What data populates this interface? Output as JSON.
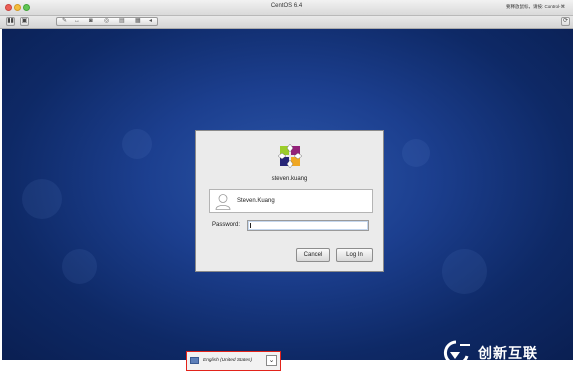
{
  "window": {
    "title": "CentOS 6.4",
    "hint": "要释放鼠标，请按: Control-⌘"
  },
  "toolbar": {
    "icons": [
      "pause-icon",
      "snapshot-icon",
      "settings-icon",
      "resize-icon",
      "lock-icon",
      "disk-icon",
      "usb-icon",
      "share-icon",
      "back-icon",
      "fullscreen-icon"
    ]
  },
  "login": {
    "hostname": "steven.kuang",
    "user_name": "Steven.Kuang",
    "password_label": "Password:",
    "password_value": "",
    "cancel_label": "Cancel",
    "login_label": "Log In"
  },
  "panel": {
    "language": "English (United States)"
  },
  "watermark": {
    "text": "创新互联"
  },
  "colors": {
    "highlight": "#e2231a",
    "desktop": "#1c3f8f"
  }
}
